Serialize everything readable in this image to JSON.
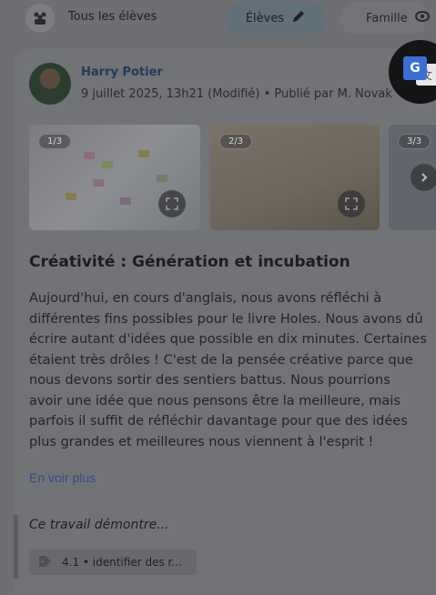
{
  "topbar": {
    "audience_label": "Tous les élèves",
    "audience_icon": "group-icon",
    "pill_eleves_label": "Élèves",
    "pill_eleves_icon": "pencil-icon",
    "pill_famille_label": "Famille",
    "pill_famille_icon": "eye-icon"
  },
  "post": {
    "author": "Harry Potier",
    "meta": "9 juillet 2025, 13h21 (Modifié) • Publié par M. Novak",
    "media": [
      {
        "badge": "1/3",
        "icon": "expand-icon"
      },
      {
        "badge": "2/3",
        "icon": "expand-icon"
      },
      {
        "badge": "3/3"
      }
    ],
    "title": "Créativité : Génération et incubation",
    "body_lines": [
      "Aujourd'hui, en cours d'anglais, nous avons réfléchi à",
      "différentes fins possibles pour le livre Holes. Nous avons dû",
      "écrire autant d'idées que possible en dix minutes. Certaines",
      "étaient très drôles ! C'est de la pensée créative parce que",
      "nous devons sortir des sentiers battus. Nous pourrions",
      "avoir une idée que nous pensons être la meilleure, mais",
      "parfois il suffit de réfléchir davantage pour que des idées",
      "plus grandes et meilleures nous viennent à l'esprit !"
    ],
    "more_link": "En voir plus",
    "demonstrates_title": "Ce travail démontre...",
    "skill_tag": "4.1 • identifier des r..."
  },
  "overlay": {
    "translate_icon": "google-translate-icon"
  },
  "colors": {
    "accent": "#2f4f86",
    "background": "#6e6f73"
  }
}
